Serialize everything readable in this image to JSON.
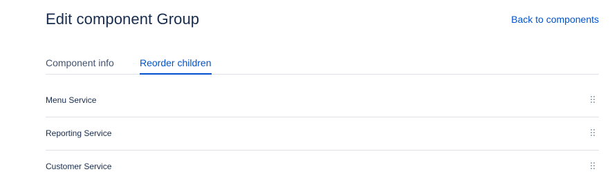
{
  "header": {
    "title": "Edit component Group",
    "back_link": "Back to components"
  },
  "tabs": [
    {
      "label": "Component info",
      "active": false
    },
    {
      "label": "Reorder children",
      "active": true
    }
  ],
  "children": [
    {
      "name": "Menu Service",
      "handle_icon": "drag-handle-icon"
    },
    {
      "name": "Reporting Service",
      "handle_icon": "drag-handle-icon"
    },
    {
      "name": "Customer Service",
      "handle_icon": "drag-handle-icon"
    }
  ],
  "colors": {
    "accent": "#0052cc",
    "text": "#172b4d",
    "muted": "#42526e",
    "divider": "#dfe1e6"
  }
}
